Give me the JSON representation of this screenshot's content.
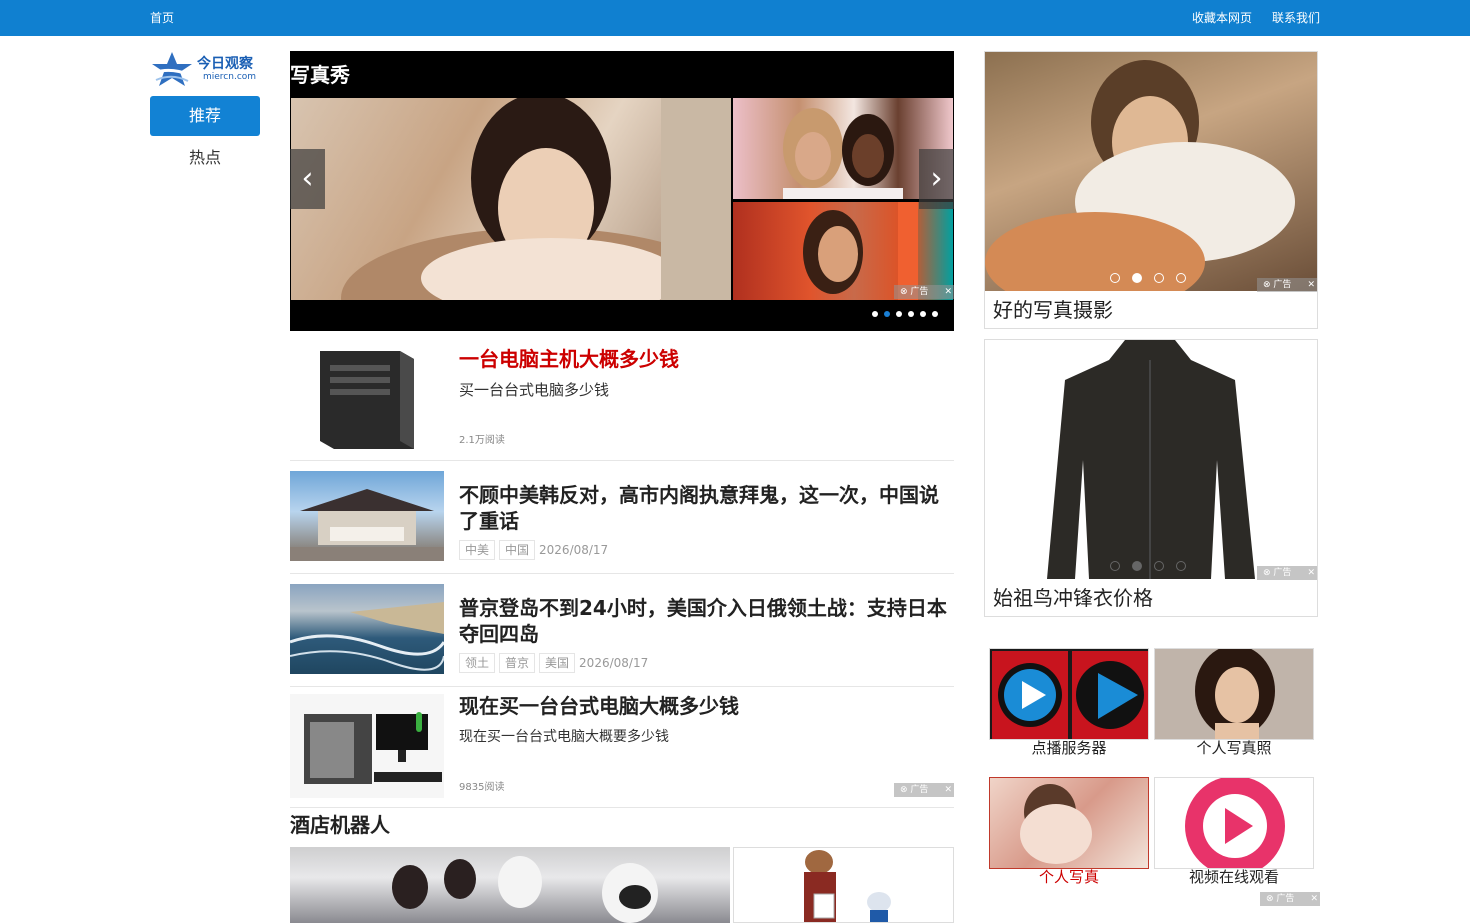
{
  "topbar": {
    "home": "首页",
    "bookmark": "收藏本网页",
    "contact": "联系我们",
    "color": "#1080d0"
  },
  "logo": {
    "brand": "今日观察",
    "domain": "miercn.com"
  },
  "nav": {
    "recommend": "推荐",
    "hot": "热点"
  },
  "slideshow": {
    "title": "写真秀",
    "ad_label": "广告",
    "active_dot": 2
  },
  "news": [
    {
      "title": "一台电脑主机大概多少钱",
      "desc": "买一台台式电脑多少钱",
      "meta": "2.1万阅读"
    },
    {
      "title": "不顾中美韩反对，高市内阁执意拜鬼，这一次，中国说了重话",
      "tags": [
        "中美",
        "中国"
      ],
      "date": "2026/08/17"
    },
    {
      "title": "普京登岛不到24小时，美国介入日俄领土战：支持日本夺回四岛",
      "tags": [
        "领土",
        "普京",
        "美国"
      ],
      "date": "2026/08/17"
    },
    {
      "title": "现在买一台台式电脑大概多少钱",
      "desc": "现在买一台台式电脑大概要多少钱",
      "meta": "9835阅读",
      "ad_label": "广告"
    }
  ],
  "section2": {
    "title": "酒店机器人"
  },
  "sidebar": {
    "card1": {
      "caption": "好的写真摄影",
      "ad_label": "广告"
    },
    "card2": {
      "caption": "始祖鸟冲锋衣价格",
      "ad_label": "广告"
    },
    "grid": [
      "点播服务器",
      "个人写真照",
      "个人写真",
      "视频在线观看"
    ],
    "grid_ad_label": "广告"
  },
  "accent": {
    "red_title": "#cc0000",
    "nav_blue": "#1282d4",
    "active_dot": "#1a7fd4"
  }
}
